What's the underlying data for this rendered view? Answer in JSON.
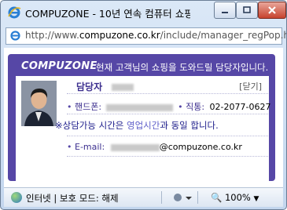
{
  "window": {
    "title": "COMPUZONE - 10년 연속 컴퓨터 쇼핑..."
  },
  "address": {
    "prefix": "http://www.",
    "domain": "compuzone.co.kr",
    "path": "/include/manager_regPop.htm"
  },
  "header": {
    "logo": "COMPUZONE",
    "text": "현재 고객님의 쇼핑을 도와드릴 담당자입니다."
  },
  "card": {
    "role_label": "담당자",
    "close_label": "[닫기]",
    "handphone_label": "핸드폰:",
    "phone_label": "직통:",
    "phone_value": "02-2077-0627",
    "notice_prefix": "※상담가능 시간은 ",
    "notice_highlight": "영업시간",
    "notice_suffix": "과 동일 합니다.",
    "email_label": "E-mail:",
    "email_domain": "@compuzone.co.kr"
  },
  "status": {
    "zone_text": "인터넷 | 보호 모드: 해제",
    "zoom": "100%"
  }
}
